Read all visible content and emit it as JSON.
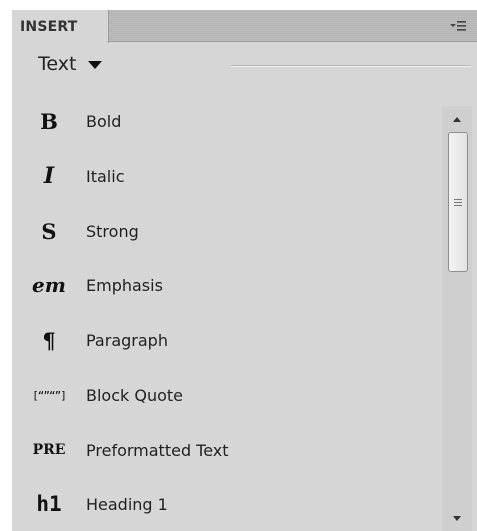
{
  "panel": {
    "tab_label": "INSERT",
    "menu_icon": "panel-options-icon"
  },
  "category": {
    "label": "Text",
    "icon": "chevron-down-icon"
  },
  "items": [
    {
      "icon_glyph": "B",
      "label": "Bold",
      "icon": "bold-icon"
    },
    {
      "icon_glyph": "I",
      "label": "Italic",
      "icon": "italic-icon"
    },
    {
      "icon_glyph": "S",
      "label": "Strong",
      "icon": "strong-icon"
    },
    {
      "icon_glyph": "em",
      "label": "Emphasis",
      "icon": "emphasis-icon"
    },
    {
      "icon_glyph": "¶",
      "label": "Paragraph",
      "icon": "paragraph-icon"
    },
    {
      "icon_glyph": "[“”“”]",
      "label": "Block Quote",
      "icon": "blockquote-icon"
    },
    {
      "icon_glyph": "PRE",
      "label": "Preformatted Text",
      "icon": "preformatted-icon"
    },
    {
      "icon_glyph": "h1",
      "label": "Heading 1",
      "icon": "heading1-icon"
    }
  ],
  "scrollbar": {
    "up_icon": "scroll-up-icon",
    "down_icon": "scroll-down-icon",
    "thumb_icon": "grip-icon"
  }
}
